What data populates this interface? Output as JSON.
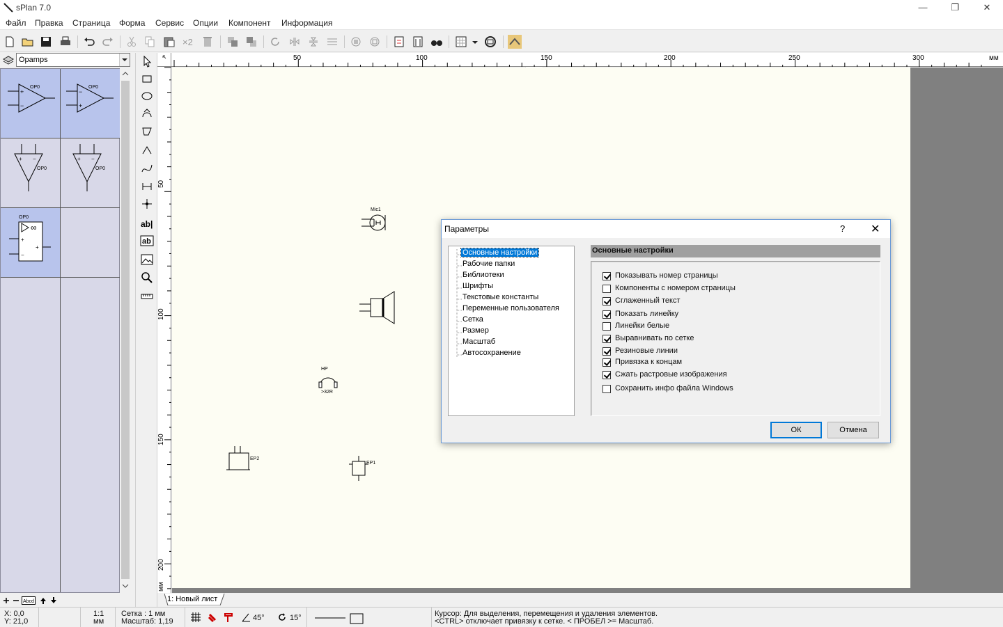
{
  "window": {
    "title": "sPlan 7.0",
    "minimize": "—",
    "restore": "❐",
    "close": "✕"
  },
  "menu": [
    "Файл",
    "Правка",
    "Страница",
    "Форма",
    "Сервис",
    "Опции",
    "Компонент",
    "Информация"
  ],
  "library": {
    "selected": "Opamps"
  },
  "ruler": {
    "unit": "мм",
    "h_ticks": [
      "50",
      "100",
      "150",
      "200",
      "250",
      "300"
    ],
    "v_ticks": [
      "50",
      "100",
      "150",
      "200"
    ],
    "v_unit": "мм"
  },
  "components": {
    "mic": "Mic1",
    "hp": "HP",
    "hp_value": ">32R",
    "ep2": "EP2",
    "ep1": "EP1",
    "opamp_labels": [
      "OP0",
      "OP0",
      "OP0",
      "OP0",
      "OP0"
    ]
  },
  "sheet_tab": "1: Новый лист",
  "status": {
    "x": "X: 0,0",
    "y": "Y: 21,0",
    "scale_ratio": "1:1",
    "scale_unit": "мм",
    "grid": "Сетка : 1 мм",
    "zoom": "Масштаб:  1,19",
    "angle1": "45°",
    "angle2": "15°",
    "hint1": "Курсор: Для выделения, перемещения и удаления элементов.",
    "hint2": "<CTRL> отключает привязку к сетке. < ПРОБЕЛ >= Масштаб."
  },
  "dialog": {
    "title": "Параметры",
    "help": "?",
    "close": "✕",
    "tree": [
      "Основные настройки",
      "Рабочие папки",
      "Библиотеки",
      "Шрифты",
      "Текстовые константы",
      "Переменные пользователя",
      "Сетка",
      "Размер",
      "Масштаб",
      "Автосохранение"
    ],
    "section": "Основные настройки",
    "options": [
      {
        "label": "Показывать номер страницы",
        "checked": true
      },
      {
        "label": "Компоненты с номером страницы",
        "checked": false
      },
      {
        "label": "Сглаженный текст",
        "checked": true
      },
      {
        "label": "Показать линейку",
        "checked": true
      },
      {
        "label": "Линейки белые",
        "checked": false
      },
      {
        "label": "Выравнивать по сетке",
        "checked": true
      },
      {
        "label": "Резиновые линии",
        "checked": true
      },
      {
        "label": "Привязка к концам",
        "checked": true
      },
      {
        "label": "Сжать растровые изображения",
        "checked": true
      },
      {
        "label": "Сохранить инфо файла Windows",
        "checked": false
      }
    ],
    "ok": "ОК",
    "cancel": "Отмена"
  }
}
